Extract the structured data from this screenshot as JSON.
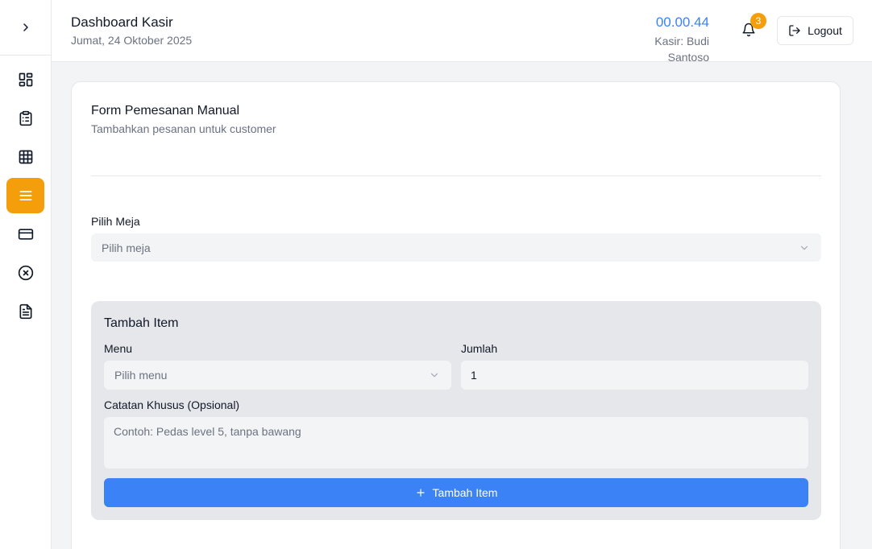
{
  "app": {
    "title": "Dashboard Kasir",
    "date": "Jumat, 24 Oktober 2025",
    "time": "00.00.44",
    "cashier": "Kasir: Budi Santoso",
    "notification_count": "3",
    "logout_label": "Logout"
  },
  "sidebar": {
    "toggle_icon": "chevron-right-icon",
    "items": [
      {
        "icon": "dashboard-icon",
        "active": false
      },
      {
        "icon": "clipboard-list-icon",
        "active": false
      },
      {
        "icon": "table-grid-icon",
        "active": false
      },
      {
        "icon": "menu-lines-icon",
        "active": true
      },
      {
        "icon": "credit-card-icon",
        "active": false
      },
      {
        "icon": "x-circle-icon",
        "active": false
      },
      {
        "icon": "document-icon",
        "active": false
      }
    ]
  },
  "form": {
    "title": "Form Pemesanan Manual",
    "subtitle": "Tambahkan pesanan untuk customer",
    "table_label": "Pilih Meja",
    "table_placeholder": "Pilih meja",
    "add_item": {
      "title": "Tambah Item",
      "menu_label": "Menu",
      "menu_placeholder": "Pilih menu",
      "qty_label": "Jumlah",
      "qty_value": "1",
      "notes_label": "Catatan Khusus (Opsional)",
      "notes_placeholder": "Contoh: Pedas level 5, tanpa bawang",
      "button_label": "Tambah Item"
    }
  },
  "colors": {
    "accent": "#f59e0b",
    "primary": "#3b82f6"
  }
}
